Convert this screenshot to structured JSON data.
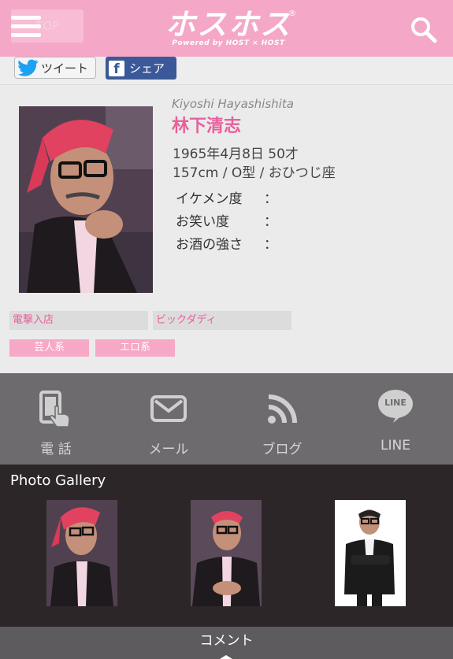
{
  "header": {
    "top_label": "TOP",
    "logo_text": "ホスホス",
    "logo_tagline": "Powered by HOST × HOST",
    "logo_mark": "®",
    "menu_icon": "hamburger-menu-icon",
    "search_icon": "search-icon",
    "background_color": "#f5a7c7"
  },
  "share": {
    "tweet_label": "ツイート",
    "facebook_label": "シェア",
    "facebook_mark": "f",
    "twitter_color": "#1da1f2",
    "facebook_color": "#3b5998"
  },
  "profile": {
    "name_romaji": "Kiyoshi Hayashishita",
    "name_jp": "林下清志",
    "birth": "1965年4月8日 50才",
    "body": "157cm / O型 / おひつじ座",
    "stats": [
      {
        "label": "イケメン度",
        "colon": "："
      },
      {
        "label": "お笑い度",
        "colon": "："
      },
      {
        "label": "お酒の強さ",
        "colon": "："
      }
    ],
    "name_color": "#e8609c"
  },
  "tags": {
    "shop_tags": [
      "電撃入店",
      "ビックダディ"
    ],
    "type_tags": [
      "芸人系",
      "エロ系"
    ]
  },
  "contact": {
    "items": [
      {
        "label": "電 話",
        "icon": "phone-tap-icon"
      },
      {
        "label": "メール",
        "icon": "mail-icon"
      },
      {
        "label": "ブログ",
        "icon": "rss-icon"
      },
      {
        "label": "LINE",
        "icon": "line-icon",
        "icon_text": "LINE"
      }
    ]
  },
  "gallery": {
    "title": "Photo Gallery"
  },
  "comment": {
    "label": "コメント"
  }
}
